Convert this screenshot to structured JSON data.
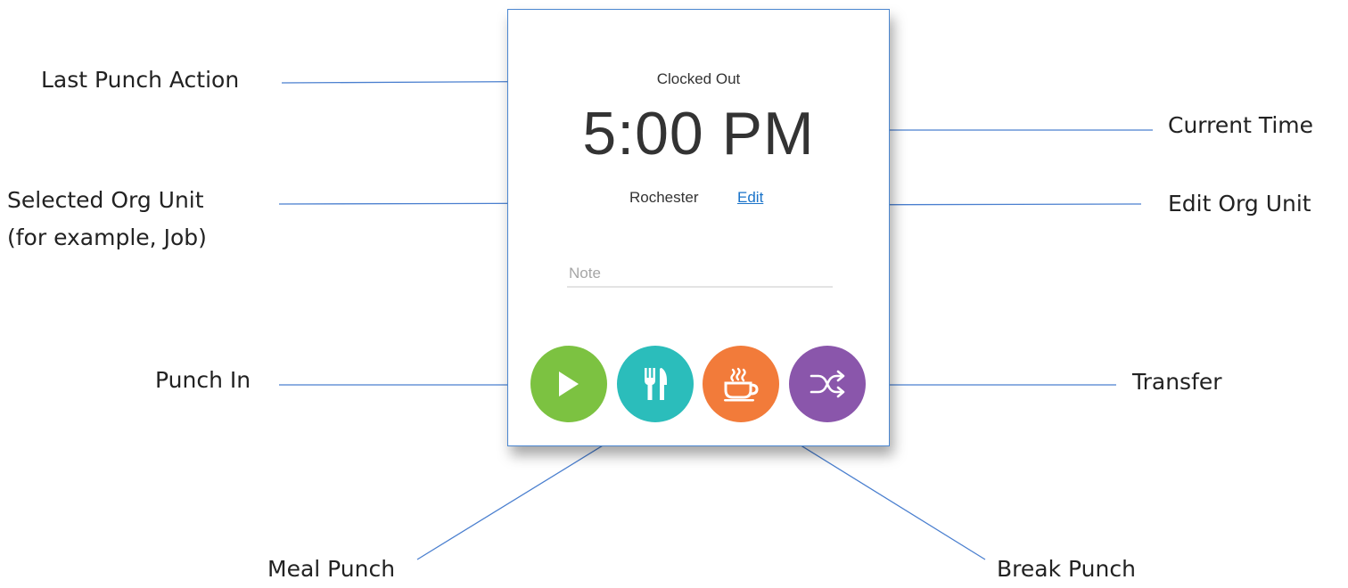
{
  "annotations": {
    "last_punch_action": "Last Punch Action",
    "selected_org_unit_line1": "Selected Org Unit",
    "selected_org_unit_line2": "(for example, Job)",
    "punch_in": "Punch In",
    "meal_punch": "Meal Punch",
    "current_time": "Current Time",
    "edit_org_unit": "Edit Org Unit",
    "transfer": "Transfer",
    "break_punch": "Break Punch"
  },
  "widget": {
    "last_punch_status": "Clocked Out",
    "current_time": "5:00 PM",
    "org_unit": "Rochester",
    "edit_link": "Edit",
    "note_placeholder": "Note",
    "buttons": [
      {
        "name": "Punch In",
        "icon": "play-icon",
        "color": "#7cc241"
      },
      {
        "name": "Meal Punch",
        "icon": "fork-knife-icon",
        "color": "#2bbdbb"
      },
      {
        "name": "Break Punch",
        "icon": "coffee-cup-icon",
        "color": "#f27b3a"
      },
      {
        "name": "Transfer",
        "icon": "shuffle-icon",
        "color": "#8a56ab"
      }
    ]
  },
  "colors": {
    "card_border": "#4a86d0",
    "leader_line": "#4a7fcf",
    "link": "#1a73c9"
  }
}
